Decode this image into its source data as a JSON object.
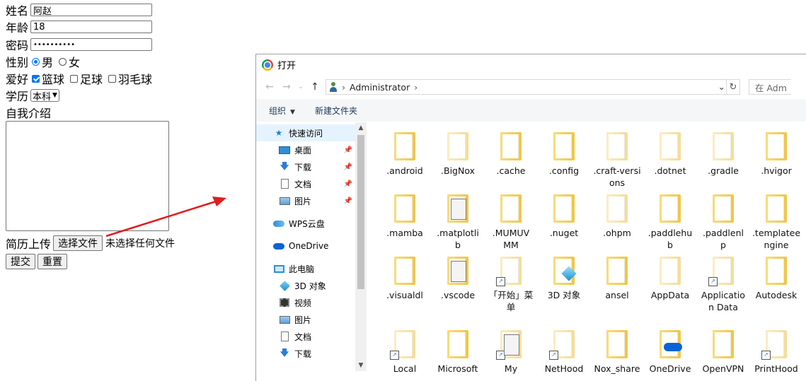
{
  "form": {
    "name": {
      "label": "姓名",
      "value": "阿赵"
    },
    "age": {
      "label": "年龄",
      "value": "18"
    },
    "password": {
      "label": "密码",
      "value": "••••••••••"
    },
    "gender": {
      "label": "性别",
      "options": [
        "男",
        "女"
      ],
      "selected": "男"
    },
    "hobbies": {
      "label": "爱好",
      "options": [
        {
          "label": "篮球",
          "checked": true
        },
        {
          "label": "足球",
          "checked": false
        },
        {
          "label": "羽毛球",
          "checked": false
        }
      ]
    },
    "education": {
      "label": "学历",
      "selected": "本科"
    },
    "intro": {
      "label": "自我介绍",
      "value": ""
    },
    "resume": {
      "label": "简历上传",
      "button": "选择文件",
      "status": "未选择任何文件"
    },
    "submit": "提交",
    "reset": "重置"
  },
  "annotation": {
    "arrow_color": "#e11d1d"
  },
  "dialog": {
    "title": "打开",
    "address": {
      "path": "Administrator",
      "search_placeholder": "在 Adm"
    },
    "toolbar": {
      "organize": "组织",
      "new_folder": "新建文件夹"
    },
    "nav": [
      {
        "label": "快速访问",
        "icon": "star-icon",
        "selected": true,
        "pinned": false
      },
      {
        "label": "桌面",
        "icon": "desktop-icon",
        "pinned": true
      },
      {
        "label": "下载",
        "icon": "download-icon",
        "pinned": true
      },
      {
        "label": "文档",
        "icon": "document-icon",
        "pinned": true
      },
      {
        "label": "图片",
        "icon": "pictures-icon",
        "pinned": true
      },
      {
        "label": "WPS云盘",
        "icon": "wps-cloud-icon"
      },
      {
        "label": "OneDrive",
        "icon": "onedrive-icon"
      },
      {
        "label": "此电脑",
        "icon": "this-pc-icon"
      },
      {
        "label": "3D 对象",
        "icon": "3d-objects-icon"
      },
      {
        "label": "视频",
        "icon": "video-icon"
      },
      {
        "label": "图片",
        "icon": "pictures-icon"
      },
      {
        "label": "文档",
        "icon": "document-icon"
      },
      {
        "label": "下载",
        "icon": "download-icon"
      }
    ],
    "items": [
      [
        ".android",
        ".BigNox",
        ".cache",
        ".config",
        ".craft-versions",
        ".dotnet",
        ".gradle",
        ".hvigor"
      ],
      [
        ".mamba",
        ".matplotlib",
        ".MUMUVMM",
        ".nuget",
        ".ohpm",
        ".paddlehub",
        ".paddlenlp",
        ".templateengine"
      ],
      [
        ".visualdl",
        ".vscode",
        "「开始」菜单",
        "3D 对象",
        "ansel",
        "AppData",
        "Application Data",
        "Autodesk"
      ],
      [
        "Local",
        "Microsoft",
        "My",
        "NetHood",
        "Nox_share",
        "OneDrive",
        "OpenVPN",
        "PrintHood"
      ]
    ],
    "items_display": [
      [
        ".android",
        ".BigNox",
        ".cache",
        ".config",
        ".craft-versi|ons",
        ".dotnet",
        ".gradle",
        ".hvigor"
      ],
      [
        ".mamba",
        ".matplotli|b",
        ".MUMUV|MM",
        ".nuget",
        ".ohpm",
        ".paddlehu|b",
        ".paddlenl|p",
        ".templatee|ngine"
      ],
      [
        ".visualdl",
        ".vscode",
        "「开始」菜|单",
        "3D 对象",
        "ansel",
        "AppData",
        "Applicatio|n Data",
        "Autodesk"
      ],
      [
        "Local",
        "Microsoft",
        "My",
        "NetHood",
        "Nox_share",
        "OneDrive",
        "OpenVPN",
        "PrintHood"
      ]
    ]
  }
}
